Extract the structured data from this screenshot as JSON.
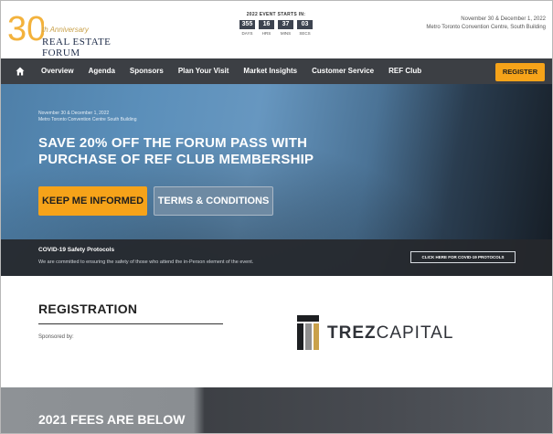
{
  "brand": {
    "logo_number": "30",
    "logo_subtitle": "th Anniversary",
    "logo_title": "REAL ESTATE FORUM",
    "accent_color": "#f6a319"
  },
  "countdown": {
    "title": "2022 EVENT STARTS IN:",
    "units": [
      {
        "value": "355",
        "label": "DAYS"
      },
      {
        "value": "16",
        "label": "HRS"
      },
      {
        "value": "37",
        "label": "MINS"
      },
      {
        "value": "03",
        "label": "SECS"
      }
    ]
  },
  "event": {
    "dates": "November 30 & December 1, 2022",
    "venue": "Metro Toronto Convention Centre, South Building"
  },
  "nav": {
    "home_icon": "home-icon",
    "items": [
      "Overview",
      "Agenda",
      "Sponsors",
      "Plan Your Visit",
      "Market Insights",
      "Customer Service",
      "REF Club"
    ],
    "register_label": "REGISTER"
  },
  "hero": {
    "date_line1": "November 30 & December 1, 2022",
    "date_line2": "Metro Toronto Convention Centre South Building",
    "title": "SAVE 20% OFF THE FORUM PASS WITH PURCHASE OF REF CLUB MEMBERSHIP",
    "inform_label": "KEEP ME INFORMED",
    "terms_label": "TERMS & CONDITIONS"
  },
  "covid": {
    "title": "COVID-19 Safety Protocols",
    "text": "We are committed to ensuring the safety of those who attend the in-Person element of the event.",
    "button_label": "CLICK HERE FOR COVID-19 PROTOCOLS"
  },
  "registration": {
    "title": "REGISTRATION",
    "sponsored_label": "Sponsored by:",
    "sponsor_bold": "TREZ",
    "sponsor_light": "CAPITAL"
  },
  "fees": {
    "title": "2021 FEES ARE BELOW"
  }
}
